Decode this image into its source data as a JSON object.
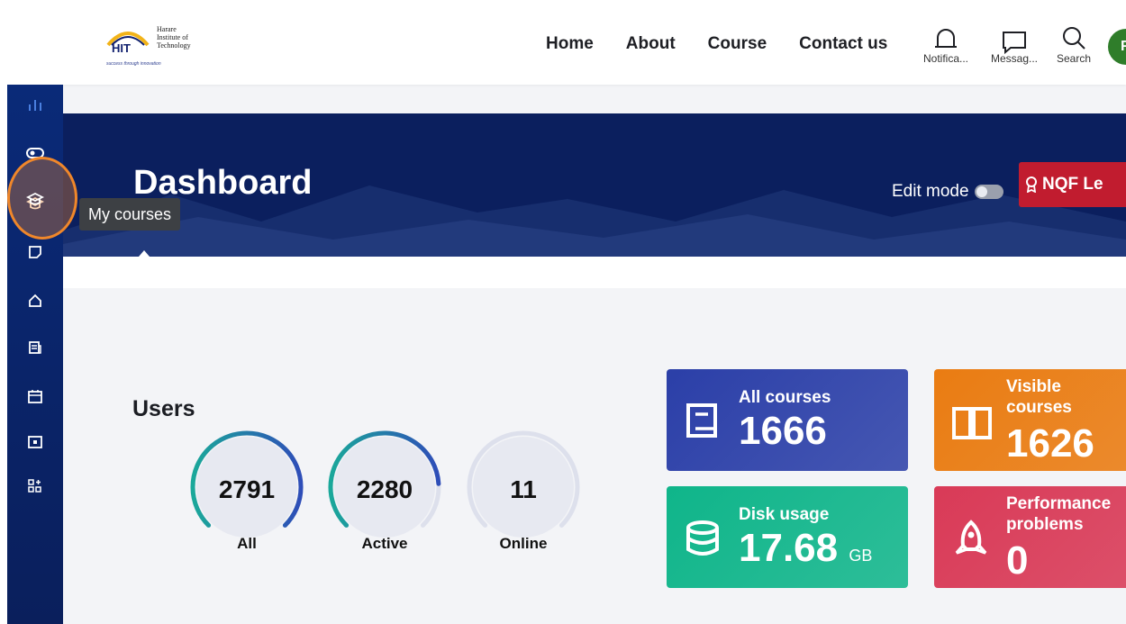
{
  "logo": {
    "line1": "Harare",
    "line2": "Institute of",
    "line3": "Technology",
    "abbr": "HIT",
    "tagline": "success through innovation"
  },
  "nav": {
    "links": [
      "Home",
      "About",
      "Course",
      "Contact us"
    ],
    "notifications_label": "Notifica...",
    "messages_label": "Messag...",
    "search_label": "Search",
    "avatar_initial": "F"
  },
  "sidebar": {
    "tooltip": "My courses",
    "highlight_color": "#f0872a"
  },
  "header": {
    "title": "Dashboard",
    "edit_mode_label": "Edit mode",
    "edit_mode_on": false,
    "nqf_button": "NQF Le"
  },
  "users": {
    "title": "Users",
    "gauges": [
      {
        "value": "2791",
        "label": "All",
        "fraction": 1.0
      },
      {
        "value": "2280",
        "label": "Active",
        "fraction": 0.82
      },
      {
        "value": "11",
        "label": "Online",
        "fraction": 0.0
      }
    ]
  },
  "cards": {
    "all_courses": {
      "title": "All courses",
      "value": "1666",
      "color": "#2b3fa8"
    },
    "visible_courses": {
      "title_line1": "Visible",
      "title_line2": "courses",
      "value": "1626",
      "color": "#ea7c12"
    },
    "disk_usage": {
      "title": "Disk usage",
      "value": "17.68",
      "unit": "GB",
      "color": "#0fb58a"
    },
    "performance": {
      "title_line1": "Performance",
      "title_line2": "problems",
      "value": "0",
      "color": "#d93a57"
    }
  },
  "colors": {
    "banner": "#0b1f5e",
    "sidebar": "#0a2a78",
    "gauge_start": "#1aa89a",
    "gauge_end": "#2e4db8"
  }
}
